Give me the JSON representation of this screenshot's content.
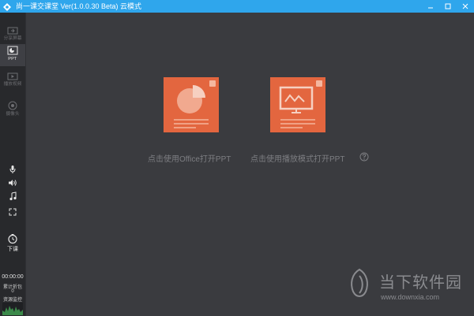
{
  "window": {
    "title": "尚一课交课堂 Ver(1.0.0.30 Beta) 云模式"
  },
  "sidebar": {
    "items": [
      {
        "label": "分享屏幕",
        "icon": "screen-share-icon"
      },
      {
        "label": "PPT",
        "icon": "ppt-icon",
        "active": true
      },
      {
        "label": "播放视频",
        "icon": "video-play-icon"
      },
      {
        "label": "摄像头",
        "icon": "camera-icon"
      }
    ],
    "controls": [
      {
        "icon": "microphone-icon"
      },
      {
        "icon": "speaker-icon"
      },
      {
        "icon": "music-icon"
      },
      {
        "icon": "fullscreen-icon"
      }
    ],
    "end_class_label": "下课",
    "timer": "00:00:00",
    "stat_label_1": "累计折包",
    "stat_value": "0",
    "stat_label_2": "资源监控"
  },
  "main": {
    "office_label": "点击使用Office打开PPT",
    "play_label": "点击使用播放模式打开PPT"
  },
  "watermark": {
    "name": "当下软件园",
    "url": "www.downxia.com"
  },
  "colors": {
    "titlebar": "#2fa6ec",
    "accent": "#e3663f",
    "background": "#3a3b3f",
    "sidebar": "#28292c"
  }
}
